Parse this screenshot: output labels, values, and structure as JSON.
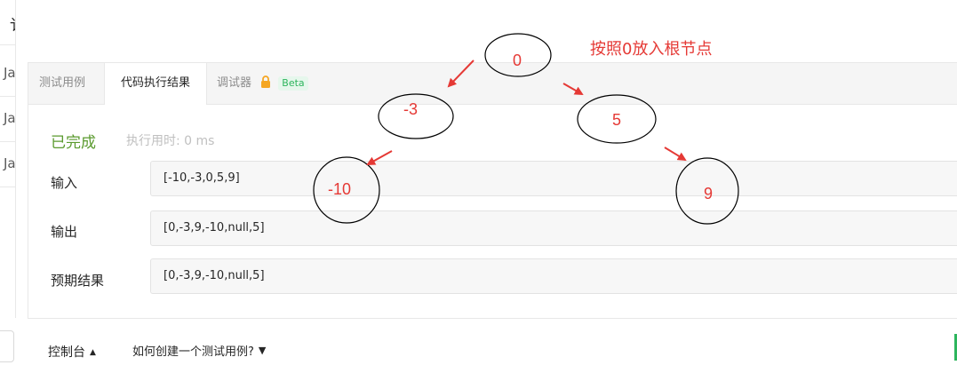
{
  "sidebar": {
    "top_char": "讠",
    "rows": [
      "Ja",
      "Ja",
      "Ja"
    ]
  },
  "tabs": [
    {
      "label": "测试用例"
    },
    {
      "label": "代码执行结果"
    },
    {
      "label": "调试器"
    }
  ],
  "beta_label": "Beta",
  "result": {
    "status": "已完成",
    "runtime_label": "执行用时: 0 ms",
    "input_label": "输入",
    "input_value": "[-10,-3,0,5,9]",
    "output_label": "输出",
    "output_value": "[0,-3,9,-10,null,5]",
    "expected_label": "预期结果",
    "expected_value": "[0,-3,9,-10,null,5]"
  },
  "bottom": {
    "console_label": "控制台",
    "howto_label": "如何创建一个测试用例?"
  },
  "annotation": {
    "note": "按照0放入根节点",
    "nodes": [
      "0",
      "-3",
      "5",
      "-10",
      "9"
    ],
    "color": "#e53935"
  }
}
